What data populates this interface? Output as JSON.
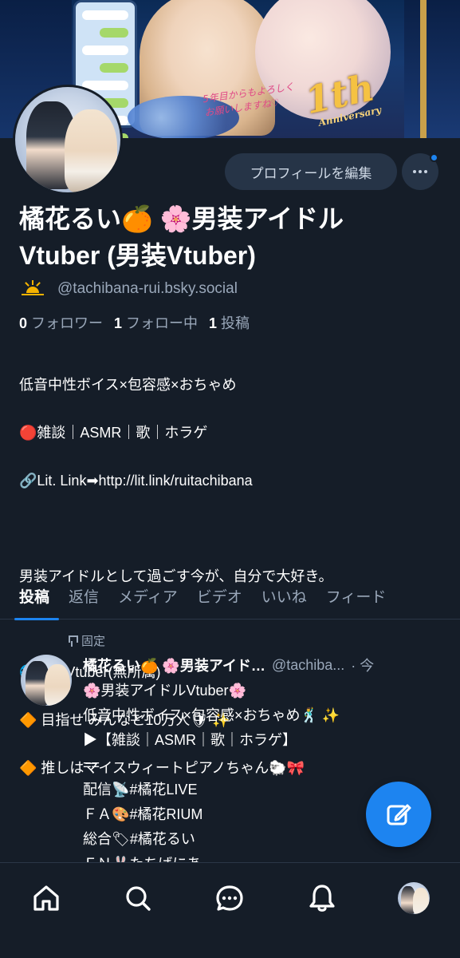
{
  "profile": {
    "edit_label": "プロフィールを編集",
    "name_line1": "橘花るい🍊 🌸男装アイドル",
    "name_line2": "Vtuber (男装Vtuber)",
    "handle": "@tachibana-rui.bsky.social",
    "stats": {
      "followers_count": "0",
      "followers_label": "フォロワー",
      "following_count": "1",
      "following_label": "フォロー中",
      "posts_count": "1",
      "posts_label": "投稿"
    },
    "bio_lines": [
      "低音中性ボイス×包容感×おちゃめ",
      "🔴雑談｜ASMR｜歌｜ホラゲ",
      "🔗Lit. Link➡http://lit.link/ruitachibana",
      "",
      "男装アイドルとして過ごす今が、自分で大好き。",
      "",
      "🌐個人Vtuber(無所属)",
      "🔶 目指せ みんなと10万人🛡 ✨",
      "🔶 推しはマイスウィートピアノちゃん🐑🎀"
    ]
  },
  "banner": {
    "anniversary_number": "1th",
    "anniversary_sub": "Anniversary",
    "message": "5年目からもよろしくお願いしますね♡"
  },
  "tabs": [
    "投稿",
    "返信",
    "メディア",
    "ビデオ",
    "いいね",
    "フィード"
  ],
  "post": {
    "pinned_label": "固定",
    "author_name": "橘花るい🍊 🌸男装アイド…",
    "author_handle": "@tachiba...",
    "time": "· 今",
    "lines": [
      "🌸男装アイドルVtuber🌸",
      "低音中性ボイス×包容感×おちゃめ🕺 ✨",
      "▶【雑談｜ASMR｜歌｜ホラゲ】",
      "==",
      "配信📡#橘花LIVE",
      "ＦＡ🎨#橘花RIUM",
      "総合🏷#橘花るい",
      "ＦＮ🐰たちばにあ"
    ]
  },
  "colors": {
    "background": "#151d28",
    "accent": "#1d84f0",
    "muted_text": "#9aa8ba",
    "button_bg": "#263447"
  },
  "nav": [
    "home-icon",
    "search-icon",
    "chat-icon",
    "bell-icon",
    "profile-avatar"
  ]
}
